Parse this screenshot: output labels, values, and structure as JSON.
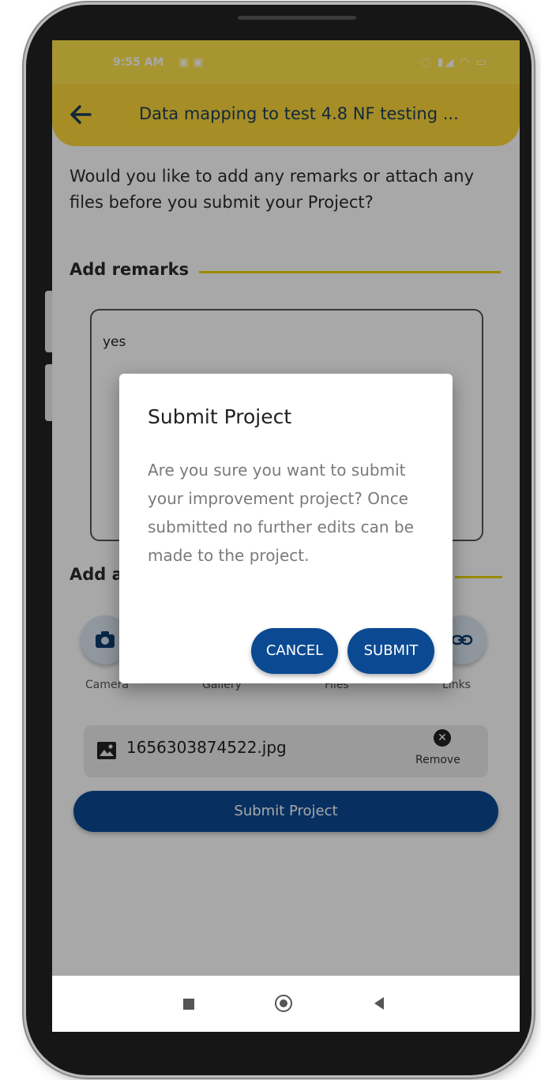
{
  "status_bar": {
    "time": "9:55 AM",
    "left_icons": "▣ ▣",
    "right_icons": "◌ ▮◢ ◠ ▭"
  },
  "app_bar": {
    "title": "Data mapping to test 4.8 NF testing ..."
  },
  "main": {
    "question": "Would you like to add any remarks or attach any files before you submit your Project?",
    "remarks_label": "Add remarks",
    "remarks_value": "yes",
    "attachments_label": "Add a",
    "attach_options": [
      {
        "label": "Camera",
        "icon": "camera-icon"
      },
      {
        "label": "Gallery",
        "icon": "gallery-icon"
      },
      {
        "label": "Files",
        "icon": "file-icon"
      },
      {
        "label": "Links",
        "icon": "link-icon"
      }
    ],
    "attached_file": {
      "name": "1656303874522.jpg",
      "icon": "image-icon",
      "remove_label": "Remove"
    },
    "submit_label": "Submit Project"
  },
  "dialog": {
    "title": "Submit Project",
    "body": "Are you sure you want to submit your improvement project? Once submitted no further edits can be made to the project.",
    "cancel_label": "CANCEL",
    "submit_label": "SUBMIT"
  },
  "colors": {
    "status_bar": "#fde34c",
    "app_bar": "#fcd63b",
    "primary_button": "#0b4a93",
    "section_line": "#e9d300"
  }
}
